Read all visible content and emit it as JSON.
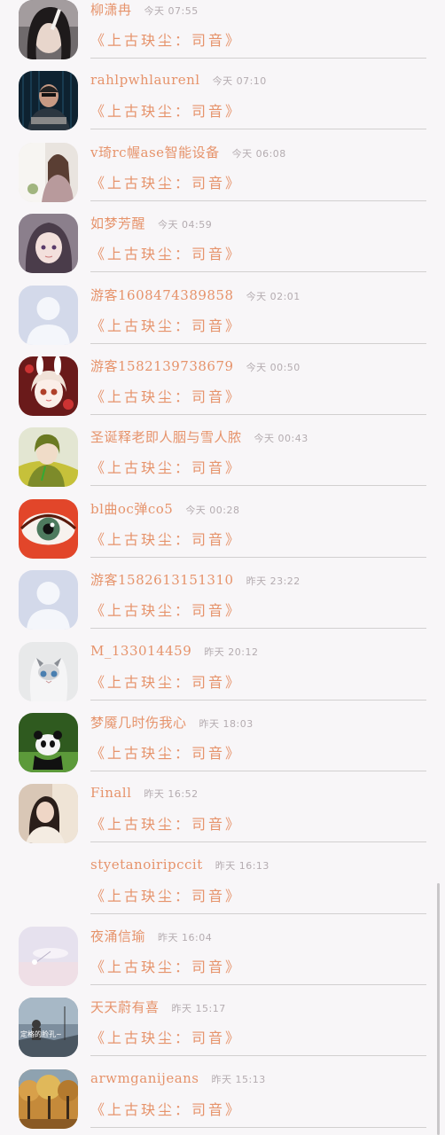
{
  "colors": {
    "accent": "#e6936b",
    "background": "#f8f6f8",
    "muted": "#b4acb0",
    "divider": "#d2d0d0"
  },
  "chat_list": [
    {
      "name": "柳潇冉",
      "time": "今天 07:55",
      "subtitle": "《上古玦尘：司音》",
      "avatar": "girl-portrait"
    },
    {
      "name": "rahlpwhlaurenl",
      "time": "今天 07:10",
      "subtitle": "《上古玦尘：司音》",
      "avatar": "hacker-portrait"
    },
    {
      "name": "v琦rc幄ase智能设备",
      "time": "今天 06:08",
      "subtitle": "《上古玦尘：司音》",
      "avatar": "girl-window"
    },
    {
      "name": "如梦芳醒",
      "time": "今天 04:59",
      "subtitle": "《上古玦尘：司音》",
      "avatar": "anime-girl"
    },
    {
      "name": "游客1608474389858",
      "time": "今天 02:01",
      "subtitle": "《上古玦尘：司音》",
      "avatar": "default-user"
    },
    {
      "name": "游客1582139738679",
      "time": "今天 00:50",
      "subtitle": "《上古玦尘：司音》",
      "avatar": "anime-bunny"
    },
    {
      "name": "圣诞释老即人胭与雪人脓",
      "time": "今天 00:43",
      "subtitle": "《上古玦尘：司音》",
      "avatar": "anime-green"
    },
    {
      "name": "bl曲oc弹co5",
      "time": "今天 00:28",
      "subtitle": "《上古玦尘：司音》",
      "avatar": "eye"
    },
    {
      "name": "游客1582613151310",
      "time": "昨天 23:22",
      "subtitle": "《上古玦尘：司音》",
      "avatar": "default-user"
    },
    {
      "name": "M_133014459",
      "time": "昨天 20:12",
      "subtitle": "《上古玦尘：司音》",
      "avatar": "cat"
    },
    {
      "name": "梦魇几时伤我心",
      "time": "昨天 18:03",
      "subtitle": "《上古玦尘：司音》",
      "avatar": "panda"
    },
    {
      "name": "Finall",
      "time": "昨天 16:52",
      "subtitle": "《上古玦尘：司音》",
      "avatar": "woman-light"
    },
    {
      "name": "styetanoiripccit",
      "time": "昨天 16:13",
      "subtitle": "《上古玦尘：司音》",
      "avatar": "none"
    },
    {
      "name": "夜涌信瑜",
      "time": "昨天 16:04",
      "subtitle": "《上古玦尘：司音》",
      "avatar": "pastel-sky"
    },
    {
      "name": "天天蔚有喜",
      "time": "昨天 15:17",
      "subtitle": "《上古玦尘：司音》",
      "avatar": "photo-caption",
      "avatar_caption": "定格的脸孔~"
    },
    {
      "name": "arwmganijeans",
      "time": "昨天 15:13",
      "subtitle": "《上古玦尘：司音》",
      "avatar": "autumn-trees"
    }
  ]
}
